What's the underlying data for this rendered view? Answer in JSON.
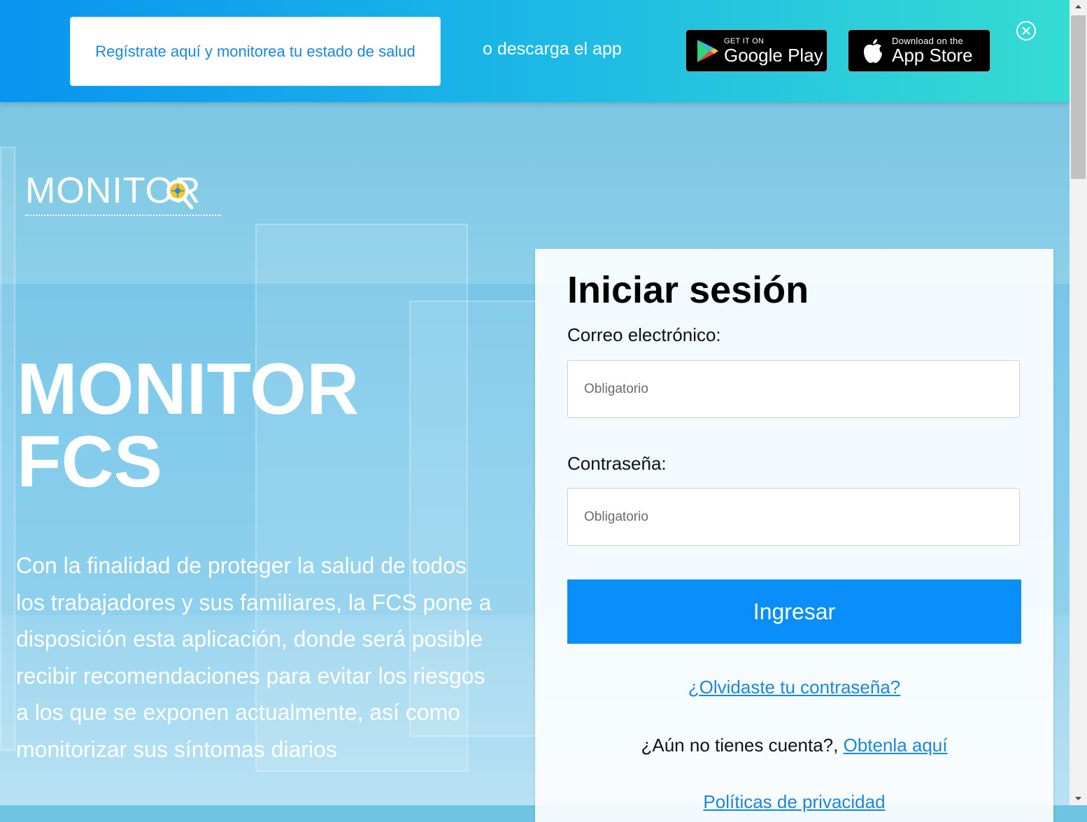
{
  "banner": {
    "register_label": "Regístrate aquí y monitorea tu estado de salud",
    "download_text": "o descarga el app",
    "google_play": {
      "small": "GET IT ON",
      "big": "Google Play"
    },
    "app_store": {
      "small": "Download on the",
      "big": "App Store"
    },
    "close_icon": "close-circle-icon"
  },
  "logo": {
    "text": "MONITOR"
  },
  "hero": {
    "title_line1": "MONITOR",
    "title_line2": "FCS",
    "description": "Con la finalidad de proteger la salud de todos los trabajadores y sus familiares, la FCS pone a disposición esta aplicación, donde será posible recibir recomendaciones para evitar los riesgos a los que se exponen actualmente, así como monitorizar sus síntomas diarios"
  },
  "login": {
    "title": "Iniciar sesión",
    "email_label": "Correo electrónico:",
    "email_placeholder": "Obligatorio",
    "email_value": "",
    "password_label": "Contraseña:",
    "password_placeholder": "Obligatorio",
    "password_value": "",
    "submit_label": "Ingresar",
    "forgot_link": "¿Olvidaste tu contraseña?",
    "no_account_text": "¿Aún no tienes cuenta?, ",
    "signup_link": "Obtenla aquí",
    "privacy_link": "Políticas de privacidad"
  },
  "colors": {
    "accent": "#0a8ef9",
    "link": "#1a86e0",
    "banner_start": "#0a93f0",
    "banner_end": "#35dcd2"
  }
}
